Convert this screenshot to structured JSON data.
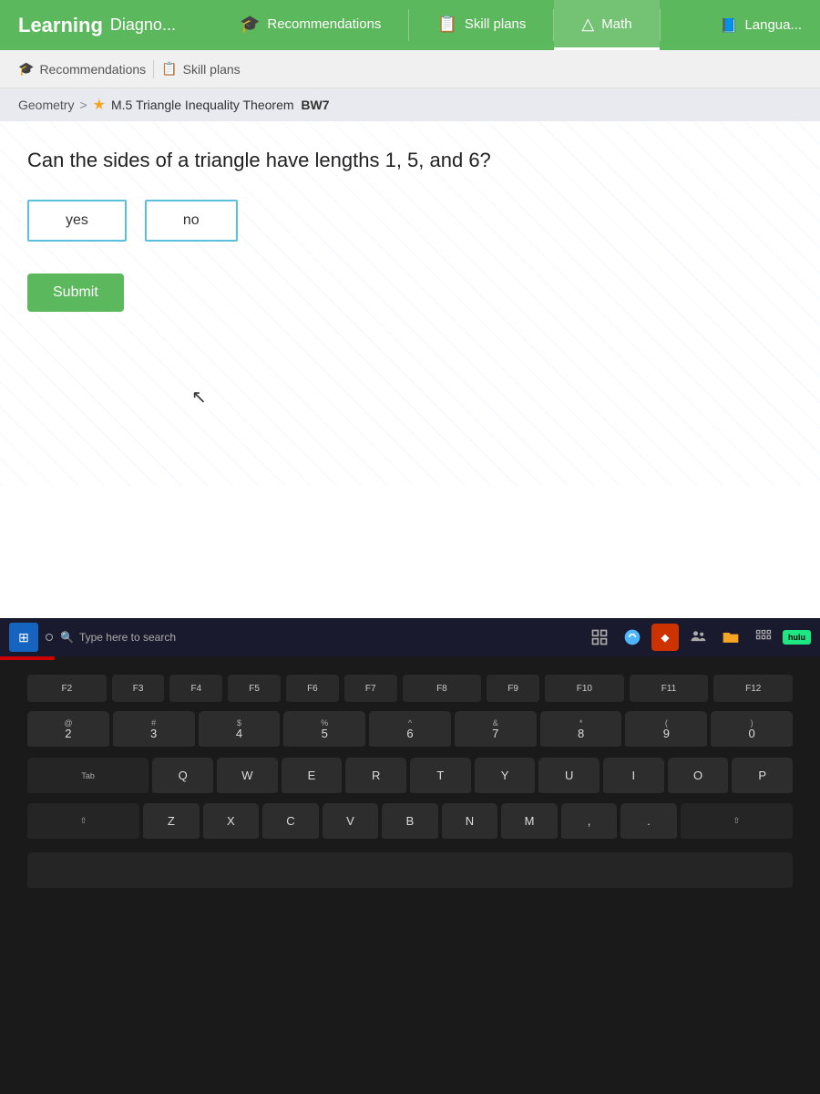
{
  "app": {
    "title": "Learning",
    "subtitle": "Diagno..."
  },
  "nav": {
    "tabs": [
      {
        "id": "recommendations",
        "label": "Recommendations",
        "icon": "🎓",
        "active": false
      },
      {
        "id": "skill-plans",
        "label": "Skill plans",
        "icon": "📋",
        "active": false
      },
      {
        "id": "math",
        "label": "Math",
        "icon": "△",
        "active": true
      },
      {
        "id": "language",
        "label": "Langua...",
        "icon": "📘",
        "active": false
      }
    ]
  },
  "breadcrumb": {
    "subject": "Geometry",
    "separator": ">",
    "star": "★",
    "lesson": "M.5 Triangle Inequality Theorem",
    "code": "BW7"
  },
  "question": {
    "text": "Can the sides of a triangle have lengths 1, 5, and 6?",
    "options": [
      {
        "id": "yes",
        "label": "yes"
      },
      {
        "id": "no",
        "label": "no"
      }
    ],
    "submit_label": "Submit"
  },
  "taskbar": {
    "search_placeholder": "Type here to search",
    "hulu_label": "hulu"
  },
  "keyboard": {
    "fn_keys": [
      "F2",
      "F3",
      "F4",
      "F5",
      "F6",
      "F7",
      "F8",
      "F9",
      "F10",
      "F11",
      "F12"
    ],
    "num_row": [
      "@\n2",
      "#\n3",
      "$\n4",
      "%\n5",
      "^\n6",
      "&\n7",
      "*\n8",
      "(\n9",
      ")\n0"
    ],
    "row1": [
      "E",
      "R",
      "T",
      "Y",
      "U"
    ],
    "labels": {
      "windows": "⊞"
    }
  }
}
